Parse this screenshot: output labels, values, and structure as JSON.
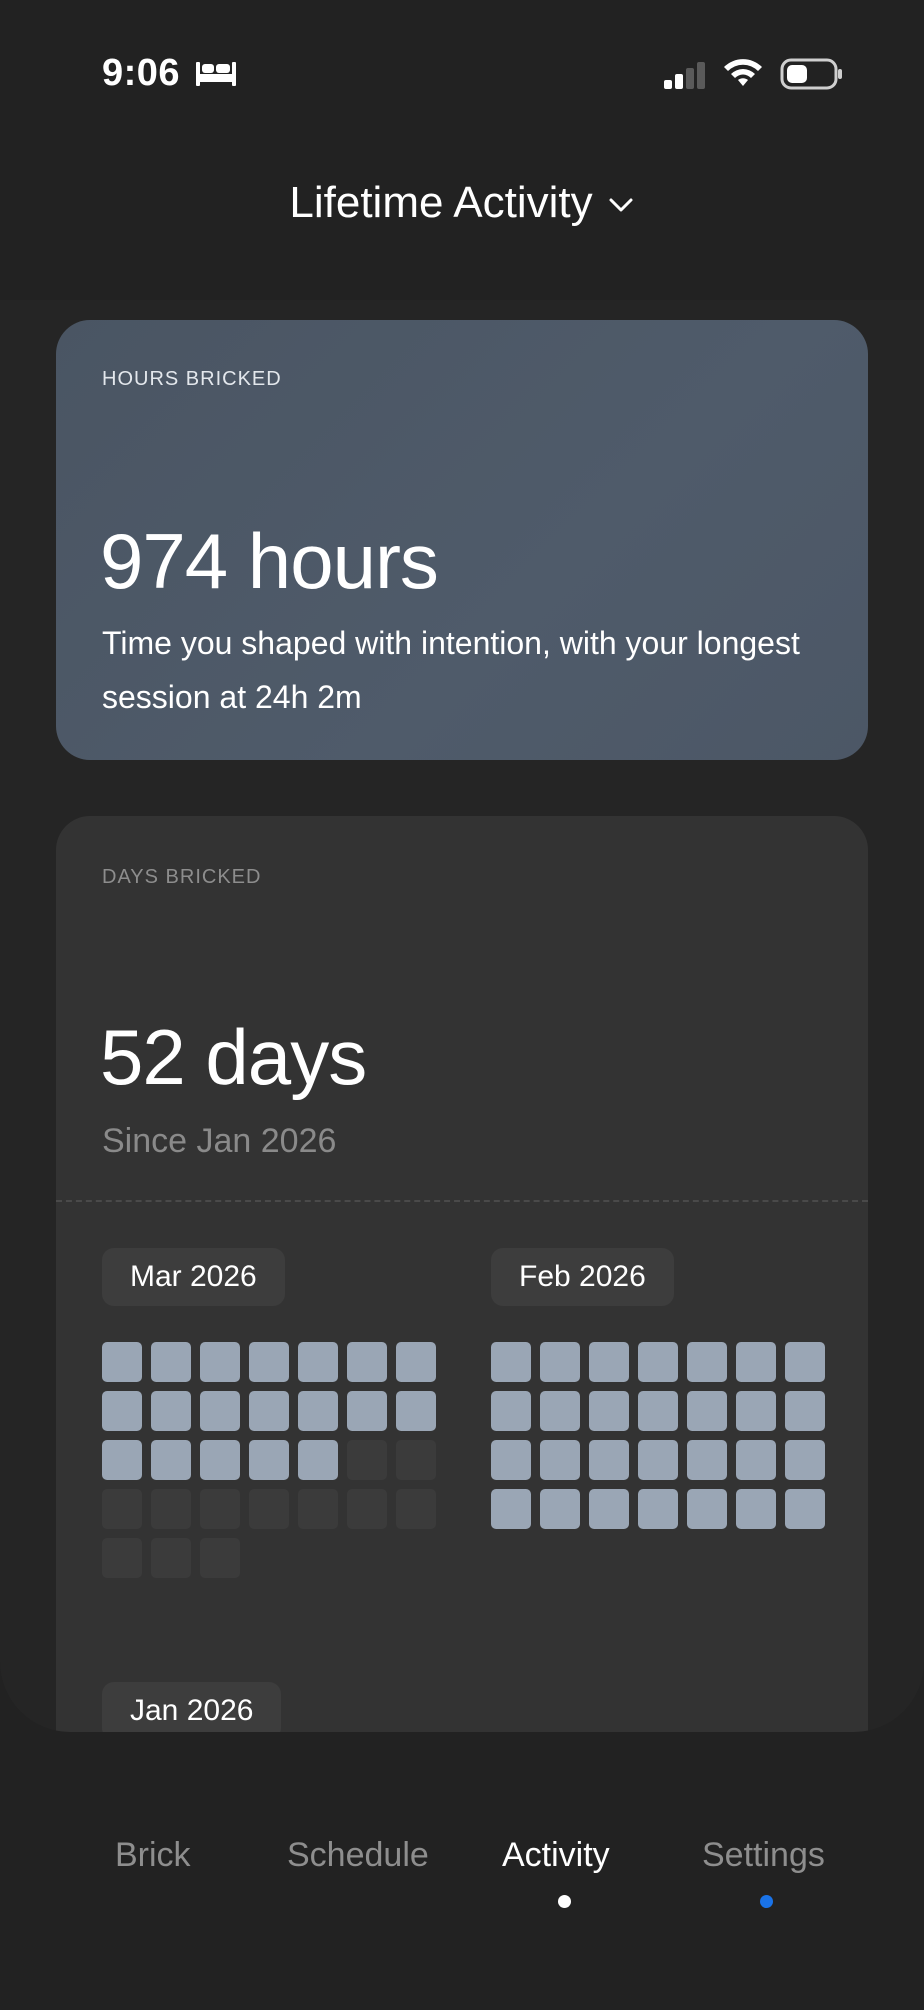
{
  "status_bar": {
    "time": "9:06",
    "focus_icon": "bed-icon",
    "signal_icon": "cellular-signal-icon",
    "wifi_icon": "wifi-icon",
    "battery_icon": "battery-icon",
    "battery_level": 0.4
  },
  "header": {
    "title": "Lifetime Activity",
    "dropdown_icon": "chevron-down-icon"
  },
  "hours_card": {
    "label": "HOURS BRICKED",
    "value": "974 hours",
    "description": "Time you shaped with intention, with your longest session at 24h 2m"
  },
  "days_card": {
    "label": "DAYS BRICKED",
    "value": "52 days",
    "since": "Since Jan 2026",
    "months": [
      {
        "label": "Mar 2026",
        "cells": [
          1,
          1,
          1,
          1,
          1,
          1,
          1,
          1,
          1,
          1,
          1,
          1,
          1,
          1,
          1,
          1,
          1,
          1,
          1,
          0,
          0,
          0,
          0,
          0,
          0,
          0,
          0,
          0,
          0,
          0,
          0
        ]
      },
      {
        "label": "Feb 2026",
        "cells": [
          1,
          1,
          1,
          1,
          1,
          1,
          1,
          1,
          1,
          1,
          1,
          1,
          1,
          1,
          1,
          1,
          1,
          1,
          1,
          1,
          1,
          1,
          1,
          1,
          1,
          1,
          1,
          1
        ]
      },
      {
        "label": "Jan 2026",
        "cells": []
      }
    ]
  },
  "tab_bar": {
    "tabs": [
      {
        "label": "Brick",
        "active": false,
        "dot": null
      },
      {
        "label": "Schedule",
        "active": false,
        "dot": null
      },
      {
        "label": "Activity",
        "active": true,
        "dot": "#ffffff"
      },
      {
        "label": "Settings",
        "active": false,
        "dot": "#1a73e8"
      }
    ]
  },
  "colors": {
    "background": "#222222",
    "hours_card": "#4b5665",
    "days_card": "#333333",
    "active_cell": "#9aa6b5",
    "inactive_cell": "#3b3b3b",
    "settings_dot": "#1a73e8"
  }
}
